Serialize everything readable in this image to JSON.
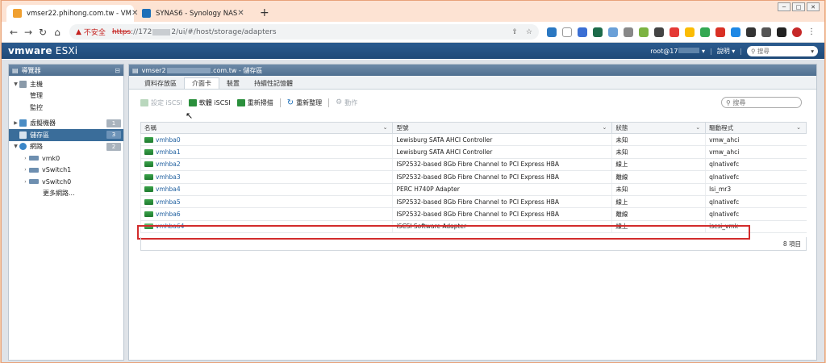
{
  "browser": {
    "tabs": [
      {
        "title": "vmser22.phihong.com.tw - VM",
        "active": true
      },
      {
        "title": "SYNAS6 - Synology NAS",
        "active": false
      }
    ],
    "new_tab": "+",
    "insecure_label": "不安全",
    "url_scheme": "https",
    "url_rest": "://172",
    "url_tail": "2/ui/#/host/storage/adapters"
  },
  "header": {
    "logo": "vmware",
    "product": "ESXi",
    "user": "root@17",
    "help": "說明",
    "search_placeholder": "搜尋"
  },
  "navigator": {
    "title": "導覽器",
    "items": [
      {
        "label": "主機",
        "level": 0,
        "arrow": "▾"
      },
      {
        "label": "管理",
        "level": 1
      },
      {
        "label": "監控",
        "level": 1
      },
      {
        "label": "虛擬機器",
        "level": 0,
        "arrow": "›",
        "badge": "1"
      },
      {
        "label": "儲存區",
        "level": 0,
        "arrow": "",
        "badge": "3",
        "selected": true
      },
      {
        "label": "網路",
        "level": 0,
        "arrow": "▾",
        "badge": "2"
      },
      {
        "label": "vmk0",
        "level": 1,
        "arrow": "›"
      },
      {
        "label": "vSwitch1",
        "level": 1,
        "arrow": "›"
      },
      {
        "label": "vSwitch0",
        "level": 1,
        "arrow": "›"
      },
      {
        "label": "更多網路...",
        "level": 2
      }
    ]
  },
  "main": {
    "title_prefix": "vmser2",
    "title_suffix": ".com.tw - 儲存區",
    "tabs": [
      "資料存放區",
      "介面卡",
      "裝置",
      "持續性記憶體"
    ],
    "active_tab": 1,
    "toolbar": {
      "configure_iscsi": "設定 iSCSI",
      "software_iscsi": "軟體 iSCSI",
      "rescan": "重新掃描",
      "refresh": "重新整理",
      "actions": "動作",
      "search_placeholder": "搜尋"
    },
    "columns": [
      "名稱",
      "型號",
      "狀態",
      "驅動程式"
    ],
    "rows": [
      {
        "name": "vmhba0",
        "model": "Lewisburg SATA AHCI Controller",
        "status": "未知",
        "driver": "vmw_ahci"
      },
      {
        "name": "vmhba1",
        "model": "Lewisburg SATA AHCI Controller",
        "status": "未知",
        "driver": "vmw_ahci"
      },
      {
        "name": "vmhba2",
        "model": "ISP2532-based 8Gb Fibre Channel to PCI Express HBA",
        "status": "線上",
        "driver": "qlnativefc"
      },
      {
        "name": "vmhba3",
        "model": "ISP2532-based 8Gb Fibre Channel to PCI Express HBA",
        "status": "離線",
        "driver": "qlnativefc"
      },
      {
        "name": "vmhba4",
        "model": "PERC H740P Adapter",
        "status": "未知",
        "driver": "lsi_mr3"
      },
      {
        "name": "vmhba5",
        "model": "ISP2532-based 8Gb Fibre Channel to PCI Express HBA",
        "status": "線上",
        "driver": "qlnativefc"
      },
      {
        "name": "vmhba6",
        "model": "ISP2532-based 8Gb Fibre Channel to PCI Express HBA",
        "status": "離線",
        "driver": "qlnativefc"
      },
      {
        "name": "vmhba64",
        "model": "iSCSI Software Adapter",
        "status": "線上",
        "driver": "iscsi_vmk"
      }
    ],
    "footer_count": "8 項目"
  },
  "colors": {
    "vm_header": "#1f4a78",
    "selected": "#3a6d9a",
    "highlight": "#d22c2c",
    "adapter_icon": "#2a8f3c"
  }
}
